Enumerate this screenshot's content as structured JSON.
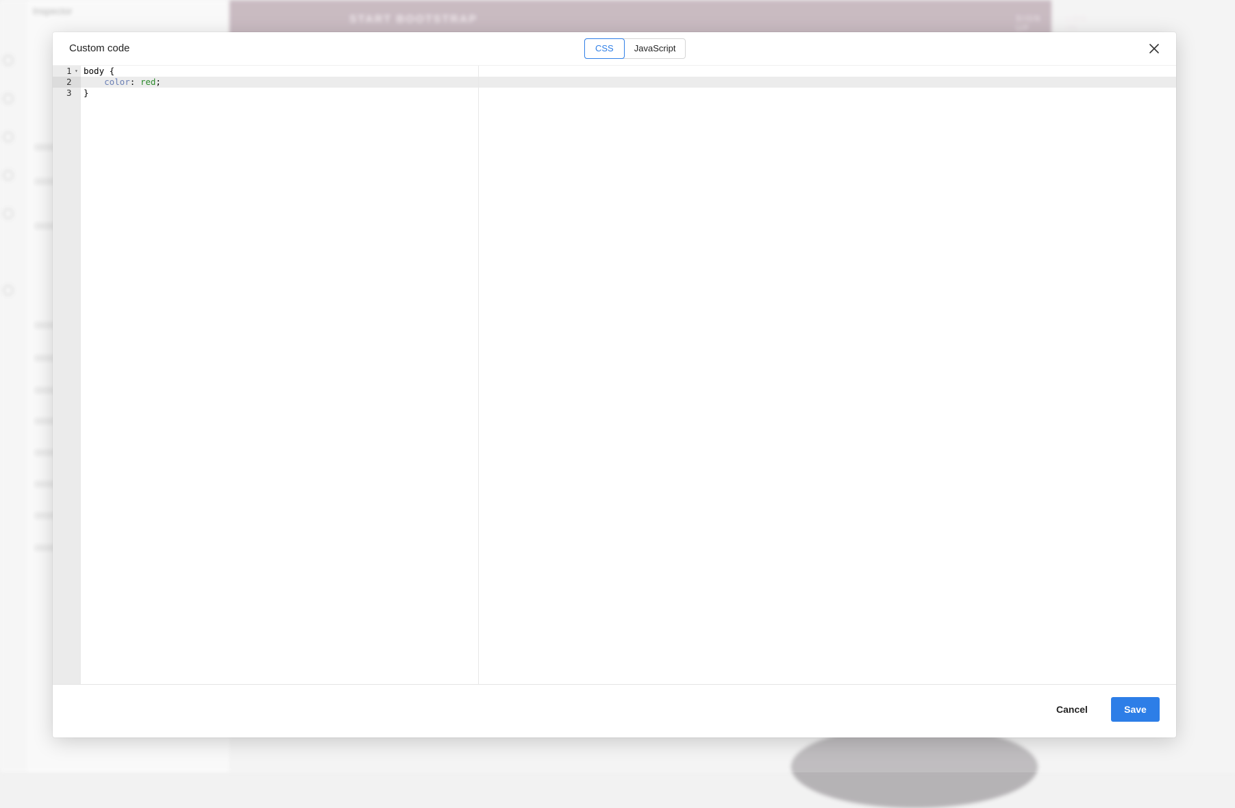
{
  "modal": {
    "title": "Custom code",
    "tabs": [
      {
        "label": "CSS",
        "active": true
      },
      {
        "label": "JavaScript",
        "active": false
      }
    ],
    "close_icon": "close-icon",
    "cancel_label": "Cancel",
    "save_label": "Save"
  },
  "editor": {
    "language": "CSS",
    "active_line": 2,
    "lines": [
      {
        "number": "1",
        "selector": "body",
        "brace": " {"
      },
      {
        "number": "2",
        "indent": "    ",
        "property": "color",
        "colon": ": ",
        "value": "red",
        "semicolon": ";"
      },
      {
        "number": "3",
        "text": "}"
      }
    ]
  },
  "colors": {
    "accent": "#2d7ee7",
    "gutter": "#ebebeb",
    "css_property": "#6a7fb5",
    "css_value": "#2e8b2e"
  },
  "background": {
    "inspector_title": "Inspector",
    "hero_brand": "START BOOTSTRAP",
    "hero_links": [
      "SIGN UP",
      "LOG IN"
    ]
  }
}
